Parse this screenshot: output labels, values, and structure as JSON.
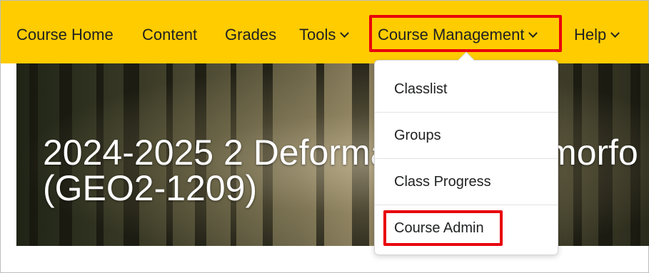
{
  "nav": {
    "items": [
      {
        "label": "Course Home"
      },
      {
        "label": "Content"
      },
      {
        "label": "Grades"
      },
      {
        "label": "Tools"
      },
      {
        "label": "Course Management"
      },
      {
        "label": "Help"
      }
    ],
    "bar_color": "#ffcc00"
  },
  "banner": {
    "title_line1": "2024-2025 2 Deformatie en geomorfo",
    "title_line2": "(GEO2-1209)"
  },
  "dropdown": {
    "items": [
      {
        "label": "Classlist"
      },
      {
        "label": "Groups"
      },
      {
        "label": "Class Progress"
      },
      {
        "label": "Course Admin"
      }
    ]
  },
  "annotation": {
    "highlight_color": "#e8000b"
  }
}
